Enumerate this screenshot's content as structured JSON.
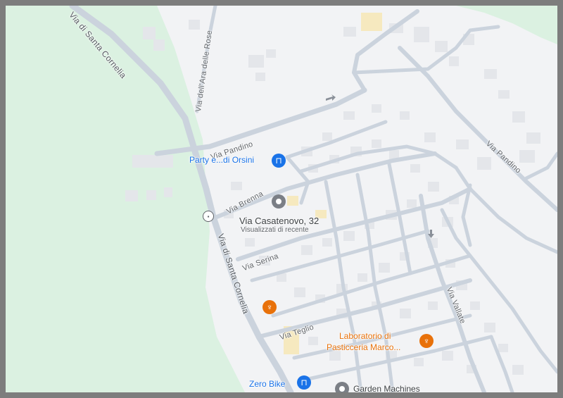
{
  "map": {
    "roads": {
      "santa_cornelia_top": "Via di Santa Cornelia",
      "ara_delle_rose": "Via dell'Ara delle Rose",
      "pandino_west": "Via Pandino",
      "pandino_east": "Via Pandino",
      "brenna": "Via Brenna",
      "serina": "Via Serina",
      "santa_cornelia_mid": "Via di Santa Cornelia",
      "teglio": "Via Teglio",
      "vallate": "Via Vallate"
    },
    "places": {
      "party": {
        "label": "Party e...di Orsini",
        "icon": "shopping-bag-icon",
        "color": "#1a73e8"
      },
      "casatenovo": {
        "label": "Via Casatenovo, 32",
        "sublabel": "Visualizzati di recente",
        "icon": "location-pin-icon",
        "color": "#3c4043"
      },
      "restaurant": {
        "icon": "fork-knife-icon",
        "color": "#e8710a"
      },
      "laboratorio": {
        "label_line1": "Laboratorio di",
        "label_line2": "Pasticceria Marco...",
        "icon": "fork-knife-icon",
        "color": "#e8710a"
      },
      "zero_bike": {
        "label": "Zero Bike",
        "icon": "shopping-bag-icon",
        "color": "#1a73e8"
      },
      "garden": {
        "label": "Garden Machines",
        "icon": "location-pin-icon",
        "color": "#3c4043"
      }
    },
    "colors": {
      "land": "#f2f3f5",
      "park": "#dbf1e1",
      "road": "#cbd3dd",
      "building": "#e4e6ea"
    }
  }
}
